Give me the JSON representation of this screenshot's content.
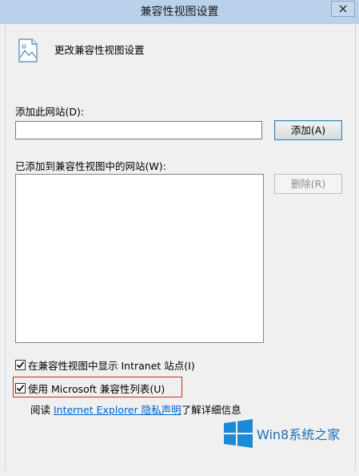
{
  "window": {
    "title": "兼容性视图设置",
    "close_icon": "close-icon"
  },
  "header": {
    "icon": "document-image-icon",
    "title": "更改兼容性视图设置"
  },
  "add_site": {
    "label": "添加此网站(D):",
    "input_value": "",
    "add_button": "添加(A)"
  },
  "added_sites": {
    "label": "已添加到兼容性视图中的网站(W):",
    "items": [],
    "remove_button": "删除(R)"
  },
  "options": {
    "show_intranet": {
      "label": "在兼容性视图中显示 Intranet 站点(I)",
      "checked": true
    },
    "use_ms_list": {
      "label": "使用 Microsoft 兼容性列表(U)",
      "checked": true
    }
  },
  "privacy": {
    "prefix": "阅读 ",
    "link": "Internet Explorer 隐私声明",
    "suffix": "了解详细信息"
  },
  "watermark": {
    "text": "Win8系统之家",
    "brand_color": "#1b6fb5"
  }
}
